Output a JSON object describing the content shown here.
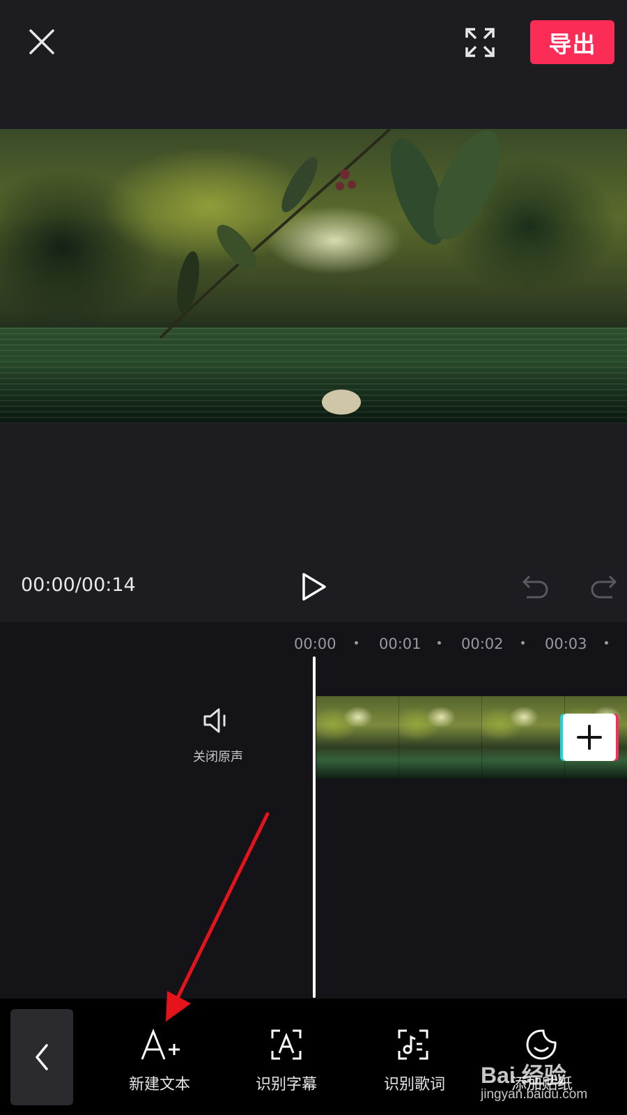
{
  "header": {
    "export_label": "导出"
  },
  "player": {
    "time": "00:00/00:14"
  },
  "timeline": {
    "ticks": [
      "00:00",
      "00:01",
      "00:02",
      "00:03"
    ],
    "mute_label": "关闭原声"
  },
  "toolbar": {
    "items": [
      {
        "label": "新建文本",
        "icon": "add-text-icon"
      },
      {
        "label": "识别字幕",
        "icon": "recognize-subtitle-icon"
      },
      {
        "label": "识别歌词",
        "icon": "recognize-lyrics-icon"
      },
      {
        "label": "添加贴纸",
        "icon": "sticker-icon"
      }
    ]
  },
  "watermark": {
    "logo": "Bai 经验",
    "url": "jingyan.baidu.com"
  },
  "colors": {
    "accent": "#fb2c55",
    "background": "#1d1c21",
    "timeline_bg": "#141317"
  }
}
